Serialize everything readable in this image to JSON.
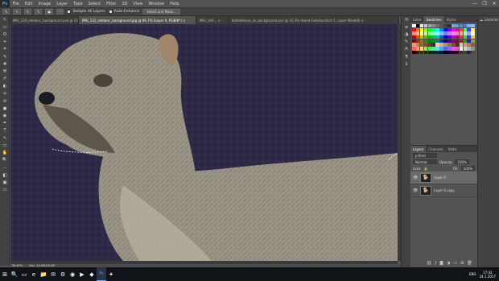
{
  "app": {
    "logo": "Ps"
  },
  "menu": [
    "File",
    "Edit",
    "Image",
    "Layer",
    "Type",
    "Select",
    "Filter",
    "3D",
    "View",
    "Window",
    "Help"
  ],
  "window_controls": [
    "—",
    "❐",
    "✕"
  ],
  "options": {
    "sample_all_layers": "Sample All Layers",
    "auto_enhance": "Auto-Enhance",
    "select_and_mask": "Select and Mask..."
  },
  "tabs": [
    {
      "label": "IMG_120_edelanc_background.psd @ 33.3% (Layer 0, RGB/8) ×",
      "active": false
    },
    {
      "label": "IMG_132_edelanc_background.jpg @ 96.7% (Layer 0, RGB/8*) ×",
      "active": true
    },
    {
      "label": "IMG_149... ×",
      "active": false
    },
    {
      "label": "Kohlebhane_no_background.psd @ 33.3% (Hund Gebräuchlich 1, Layer Mask/8) ×",
      "active": false
    }
  ],
  "tools": [
    "↖",
    "▭",
    "ʘ",
    "⌖",
    "⌗",
    "✎",
    "✚",
    "⚒",
    "✐",
    "◐",
    "⌂",
    "⊘",
    "◼",
    "◉",
    "✒",
    "T",
    "↖",
    "▭",
    "✋",
    "🔍",
    "…",
    "◧",
    "▣",
    "▭"
  ],
  "status": {
    "zoom": "96.67%",
    "doc": "Doc: 10.0M/25.0M"
  },
  "swatch_panel": {
    "tabs": [
      "Color",
      "Swatches",
      "Styles"
    ],
    "active": "Swatches"
  },
  "swatch_colors": [
    "#ffffff",
    "#000000",
    "#e8e8e8",
    "#c8c8c8",
    "#a0a0a0",
    "#888888",
    "#707070",
    "#585858",
    "#404040",
    "#2c2c2c",
    "#6aa8ff",
    "#5b9cf0",
    "#4d8ee0",
    "#3f80d0",
    "#78b0ff",
    "#8cc0ff",
    "#ff0000",
    "#ff7f00",
    "#ffff00",
    "#7fff00",
    "#00ff00",
    "#00ff7f",
    "#00ffff",
    "#007fff",
    "#0000ff",
    "#7f00ff",
    "#ff00ff",
    "#ff007f",
    "#ff4040",
    "#40ff40",
    "#4040ff",
    "#ffff40",
    "#ff8080",
    "#ffbf80",
    "#ffff80",
    "#bfff80",
    "#80ff80",
    "#80ffbf",
    "#80ffff",
    "#80bfff",
    "#8080ff",
    "#bf80ff",
    "#ff80ff",
    "#ff80bf",
    "#ffa0a0",
    "#a0ffa0",
    "#a0a0ff",
    "#ffffa0",
    "#c00000",
    "#c06000",
    "#c0c000",
    "#60c000",
    "#00c000",
    "#00c060",
    "#00c0c0",
    "#0060c0",
    "#0000c0",
    "#6000c0",
    "#c000c0",
    "#c00060",
    "#d04040",
    "#40d040",
    "#4040d0",
    "#d0d040",
    "#800000",
    "#804000",
    "#808000",
    "#408000",
    "#008000",
    "#008040",
    "#008080",
    "#004080",
    "#000080",
    "#400080",
    "#800080",
    "#800040",
    "#a02020",
    "#20a020",
    "#2020a0",
    "#a0a020",
    "#e0a080",
    "#c08060",
    "#a06040",
    "#805030",
    "#604020",
    "#403020",
    "#f0d0b0",
    "#d0b090",
    "#b09070",
    "#907050",
    "#705030",
    "#503010",
    "#e0c0a0",
    "#c0a080",
    "#a08060",
    "#806040",
    "#ff6060",
    "#ffa060",
    "#ffe060",
    "#a0e060",
    "#60e060",
    "#60e0a0",
    "#60e0e0",
    "#60a0e0",
    "#6060e0",
    "#a060e0",
    "#e060e0",
    "#e060a0",
    "#f0f0f0",
    "#d0d0d0",
    "#b0b0b0",
    "#909090",
    "#300000",
    "#302000",
    "#303000",
    "#103000",
    "#003000",
    "#003020",
    "#003030",
    "#001830",
    "#000030",
    "#180030",
    "#300030",
    "#300018",
    "#502020",
    "#205020",
    "#202050",
    "#505020"
  ],
  "layers_panel": {
    "tabs": [
      "Layers",
      "Channels",
      "Paths"
    ],
    "active": "Layers",
    "kind": "ρ Kind",
    "blend_mode": "Normal",
    "opacity_label": "Opacity:",
    "opacity": "100%",
    "lock_label": "Lock:",
    "fill_label": "Fill:",
    "fill": "100%",
    "layers": [
      {
        "name": "Layer 0",
        "selected": true
      },
      {
        "name": "Layer 0 copy",
        "selected": false
      }
    ]
  },
  "right_panel": {
    "libraries": "Libraries"
  },
  "taskbar": {
    "icons": [
      "⊞",
      "🔍",
      "▭",
      "e",
      "📁",
      "✉",
      "⚙",
      "◉",
      "▶",
      "◆",
      "Ps",
      "✦"
    ],
    "language": "ENG",
    "time": "17:42",
    "date": "24.1.2017"
  }
}
